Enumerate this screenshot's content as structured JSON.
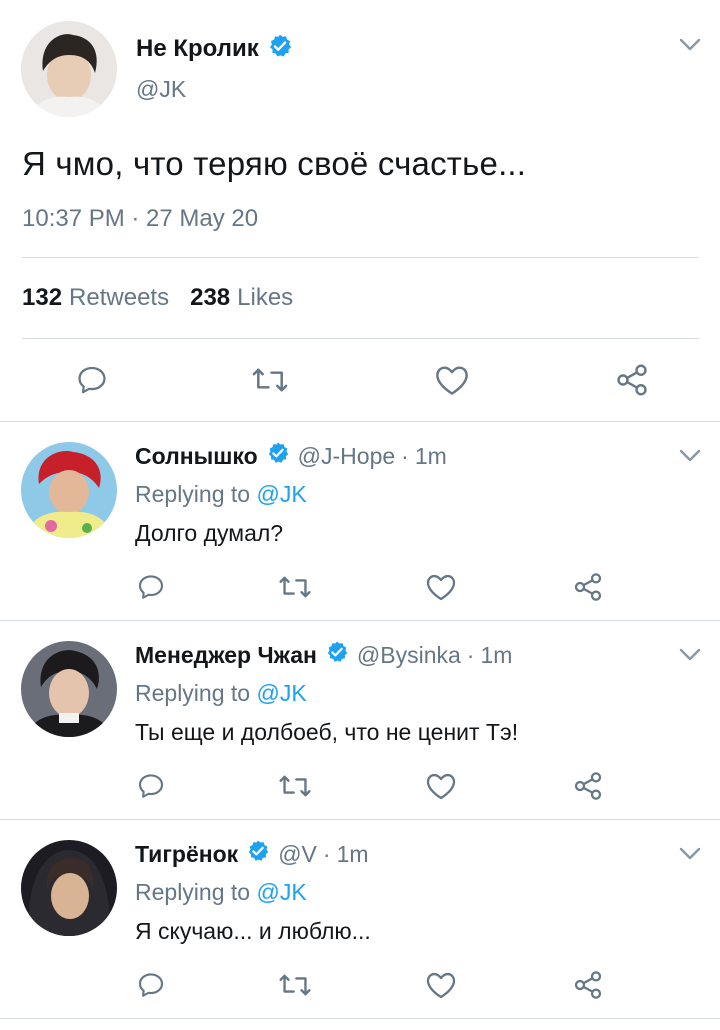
{
  "main_tweet": {
    "name": "Не Кролик",
    "handle": "@JK",
    "text": "Я чмо, что теряю своё счастье...",
    "timestamp": "10:37 PM · 27 May 20",
    "retweets_count": "132",
    "retweets_label": "Retweets",
    "likes_count": "238",
    "likes_label": "Likes",
    "verified": true
  },
  "replies": [
    {
      "name": "Солнышко",
      "handle": "@J-Hope",
      "time": "1m",
      "replying_prefix": "Replying to",
      "replying_to": "@JK",
      "text": "Долго думал?"
    },
    {
      "name": "Менеджер Чжан",
      "handle": "@Bysinka",
      "time": "1m",
      "replying_prefix": "Replying to",
      "replying_to": "@JK",
      "text": "Ты еще и долбоеб, что не ценит Тэ!"
    },
    {
      "name": "Тигрёнок",
      "handle": "@V",
      "time": "1m",
      "replying_prefix": "Replying to",
      "replying_to": "@JK",
      "text": "Я скучаю... и люблю..."
    }
  ],
  "icons": {
    "reply": "reply-icon",
    "retweet": "retweet-icon",
    "like": "heart-icon",
    "share": "share-icon",
    "verified": "verified-badge-icon",
    "more": "chevron-down-icon"
  },
  "colors": {
    "accent": "#1da1f2",
    "secondary_text": "#657786",
    "icon_gray": "#657786",
    "divider": "#d8dde2"
  }
}
